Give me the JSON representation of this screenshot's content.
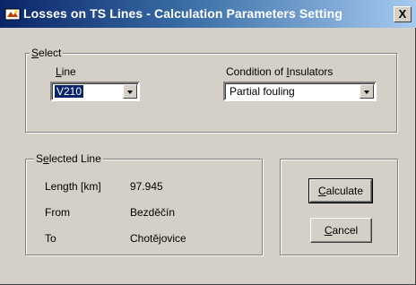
{
  "window": {
    "title": "Losses on TS Lines - Calculation Parameters Setting",
    "close_glyph": "X",
    "icon": "app-icon"
  },
  "select_group": {
    "title_accesskey": "S",
    "title_rest": "elect",
    "line": {
      "label_accesskey": "L",
      "label_rest": "ine",
      "value": "V210"
    },
    "insulators": {
      "label_before": "Condition of ",
      "label_accesskey": "I",
      "label_after": "nsulators",
      "value": "Partial fouling"
    }
  },
  "selected_line_group": {
    "title_before": "S",
    "title_accesskey": "e",
    "title_after": "lected Line",
    "rows": [
      {
        "label": "Length [km]",
        "value": "97.945"
      },
      {
        "label": "From",
        "value": "Bezděčín"
      },
      {
        "label": "To",
        "value": "Chotějovice"
      }
    ]
  },
  "buttons": {
    "calculate": {
      "accesskey": "C",
      "rest": "alculate"
    },
    "cancel": {
      "accesskey": "C",
      "rest": "ancel"
    }
  },
  "colors": {
    "title_active": "#0a246a",
    "title_gradient_end": "#a6caf0",
    "face": "#d4d0c8",
    "selection": "#0a246a"
  }
}
